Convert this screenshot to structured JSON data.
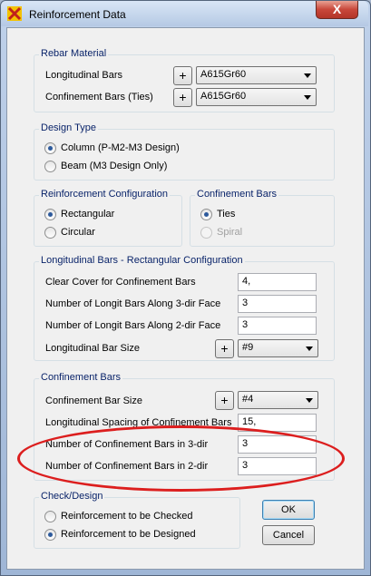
{
  "window": {
    "title": "Reinforcement Data",
    "close_glyph": "X",
    "icon": "app-logo-icon"
  },
  "rebar_material": {
    "title": "Rebar Material",
    "longitudinal_label": "Longitudinal Bars",
    "longitudinal_value": "A615Gr60",
    "confinement_label": "Confinement Bars  (Ties)",
    "confinement_value": "A615Gr60",
    "plus": "+"
  },
  "design_type": {
    "title": "Design Type",
    "options": [
      "Column  (P-M2-M3 Design)",
      "Beam  (M3 Design Only)"
    ],
    "selected": 0
  },
  "reinforcement_config": {
    "title": "Reinforcement Configuration",
    "options": [
      "Rectangular",
      "Circular"
    ],
    "selected": 0
  },
  "confinement_type": {
    "title": "Confinement Bars",
    "options": [
      "Ties",
      "Spiral"
    ],
    "selected": 0
  },
  "longitudinal": {
    "title": "Longitudinal Bars - Rectangular Configuration",
    "clear_cover_label": "Clear Cover for Confinement Bars",
    "clear_cover_value": "4,",
    "bars_3dir_label": "Number of Longit Bars Along 3-dir Face",
    "bars_3dir_value": "3",
    "bars_2dir_label": "Number of Longit Bars Along 2-dir Face",
    "bars_2dir_value": "3",
    "bar_size_label": "Longitudinal Bar Size",
    "bar_size_value": "#9"
  },
  "confinement": {
    "title": "Confinement Bars",
    "bar_size_label": "Confinement Bar Size",
    "bar_size_value": "#4",
    "spacing_label": "Longitudinal Spacing of Confinement Bars",
    "spacing_value": "15,",
    "bars_3dir_label": "Number of Confinement Bars in 3-dir",
    "bars_3dir_value": "3",
    "bars_2dir_label": "Number of Confinement Bars in 2-dir",
    "bars_2dir_value": "3"
  },
  "check_design": {
    "title": "Check/Design",
    "options": [
      "Reinforcement to be Checked",
      "Reinforcement to be Designed"
    ],
    "selected": 1
  },
  "buttons": {
    "ok": "OK",
    "cancel": "Cancel"
  },
  "annotation": {
    "color": "#dc1e1e",
    "shape": "ellipse"
  }
}
